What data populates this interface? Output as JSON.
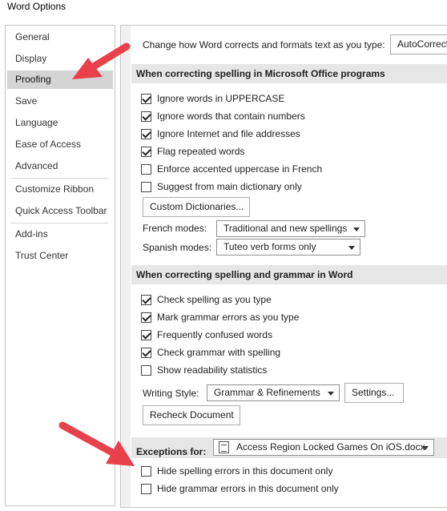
{
  "window": {
    "title": "Word Options"
  },
  "sidebar": {
    "items": [
      {
        "label": "General"
      },
      {
        "label": "Display"
      },
      {
        "label": "Proofing"
      },
      {
        "label": "Save"
      },
      {
        "label": "Language"
      },
      {
        "label": "Ease of Access"
      },
      {
        "label": "Advanced"
      },
      {
        "label": "Customize Ribbon"
      },
      {
        "label": "Quick Access Toolbar"
      },
      {
        "label": "Add-ins"
      },
      {
        "label": "Trust Center"
      }
    ],
    "selected": "Proofing"
  },
  "autocorrect": {
    "prompt": "Change how Word corrects and formats text as you type:",
    "button_label": "AutoCorrect Options..."
  },
  "office_section": {
    "header": "When correcting spelling in Microsoft Office programs",
    "options": [
      {
        "label": "Ignore words in UPPERCASE",
        "checked": true
      },
      {
        "label": "Ignore words that contain numbers",
        "checked": true
      },
      {
        "label": "Ignore Internet and file addresses",
        "checked": true
      },
      {
        "label": "Flag repeated words",
        "checked": true
      },
      {
        "label": "Enforce accented uppercase in French",
        "checked": false
      },
      {
        "label": "Suggest from main dictionary only",
        "checked": false
      }
    ],
    "custom_dictionaries_label": "Custom Dictionaries...",
    "french_modes_label": "French modes:",
    "french_modes_value": "Traditional and new spellings",
    "spanish_modes_label": "Spanish modes:",
    "spanish_modes_value": "Tuteo verb forms only"
  },
  "word_section": {
    "header": "When correcting spelling and grammar in Word",
    "options": [
      {
        "label": "Check spelling as you type",
        "checked": true
      },
      {
        "label": "Mark grammar errors as you type",
        "checked": true
      },
      {
        "label": "Frequently confused words",
        "checked": true
      },
      {
        "label": "Check grammar with spelling",
        "checked": true
      },
      {
        "label": "Show readability statistics",
        "checked": false
      }
    ],
    "writing_style_label": "Writing Style:",
    "writing_style_value": "Grammar & Refinements",
    "settings_label": "Settings...",
    "recheck_label": "Recheck Document"
  },
  "exceptions": {
    "label": "Exceptions for:",
    "document": "Access Region Locked Games On iOS.docx",
    "options": [
      {
        "label": "Hide spelling errors in this document only",
        "checked": false
      },
      {
        "label": "Hide grammar errors in this document only",
        "checked": false
      }
    ]
  },
  "colors": {
    "arrow": "#e8414b",
    "selected_nav": "#d4d4d4",
    "section_header": "#e6e6e6"
  }
}
